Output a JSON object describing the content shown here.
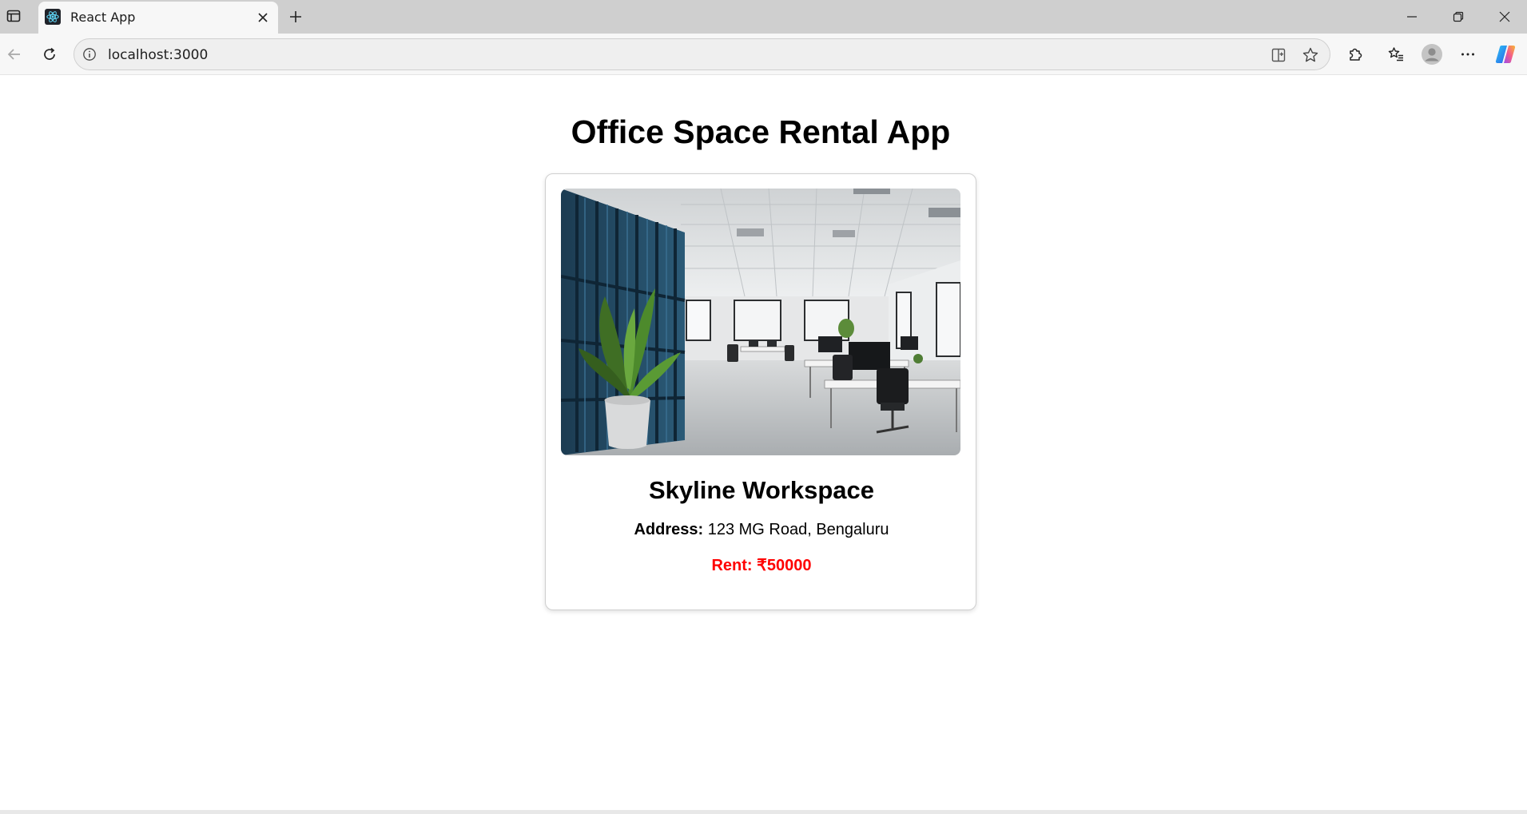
{
  "browser": {
    "tab_title": "React App",
    "url": "localhost:3000"
  },
  "app": {
    "title": "Office Space Rental App"
  },
  "office": {
    "name": "Skyline Workspace",
    "address_label": "Address:",
    "address": "123 MG Road, Bengaluru",
    "rent_label": "Rent:",
    "rent": "₹50000",
    "rent_color": "#ff0000",
    "image": "office-interior-photo"
  },
  "icons": {
    "favicon": "react-icon",
    "back": "back-arrow-icon",
    "reload": "reload-icon",
    "site_info": "info-icon",
    "split_screen": "split-screen-icon",
    "favorite": "star-icon",
    "extensions": "puzzle-icon",
    "favorites": "favorites-icon",
    "profile": "profile-icon",
    "more": "more-icon",
    "copilot": "copilot-icon"
  }
}
